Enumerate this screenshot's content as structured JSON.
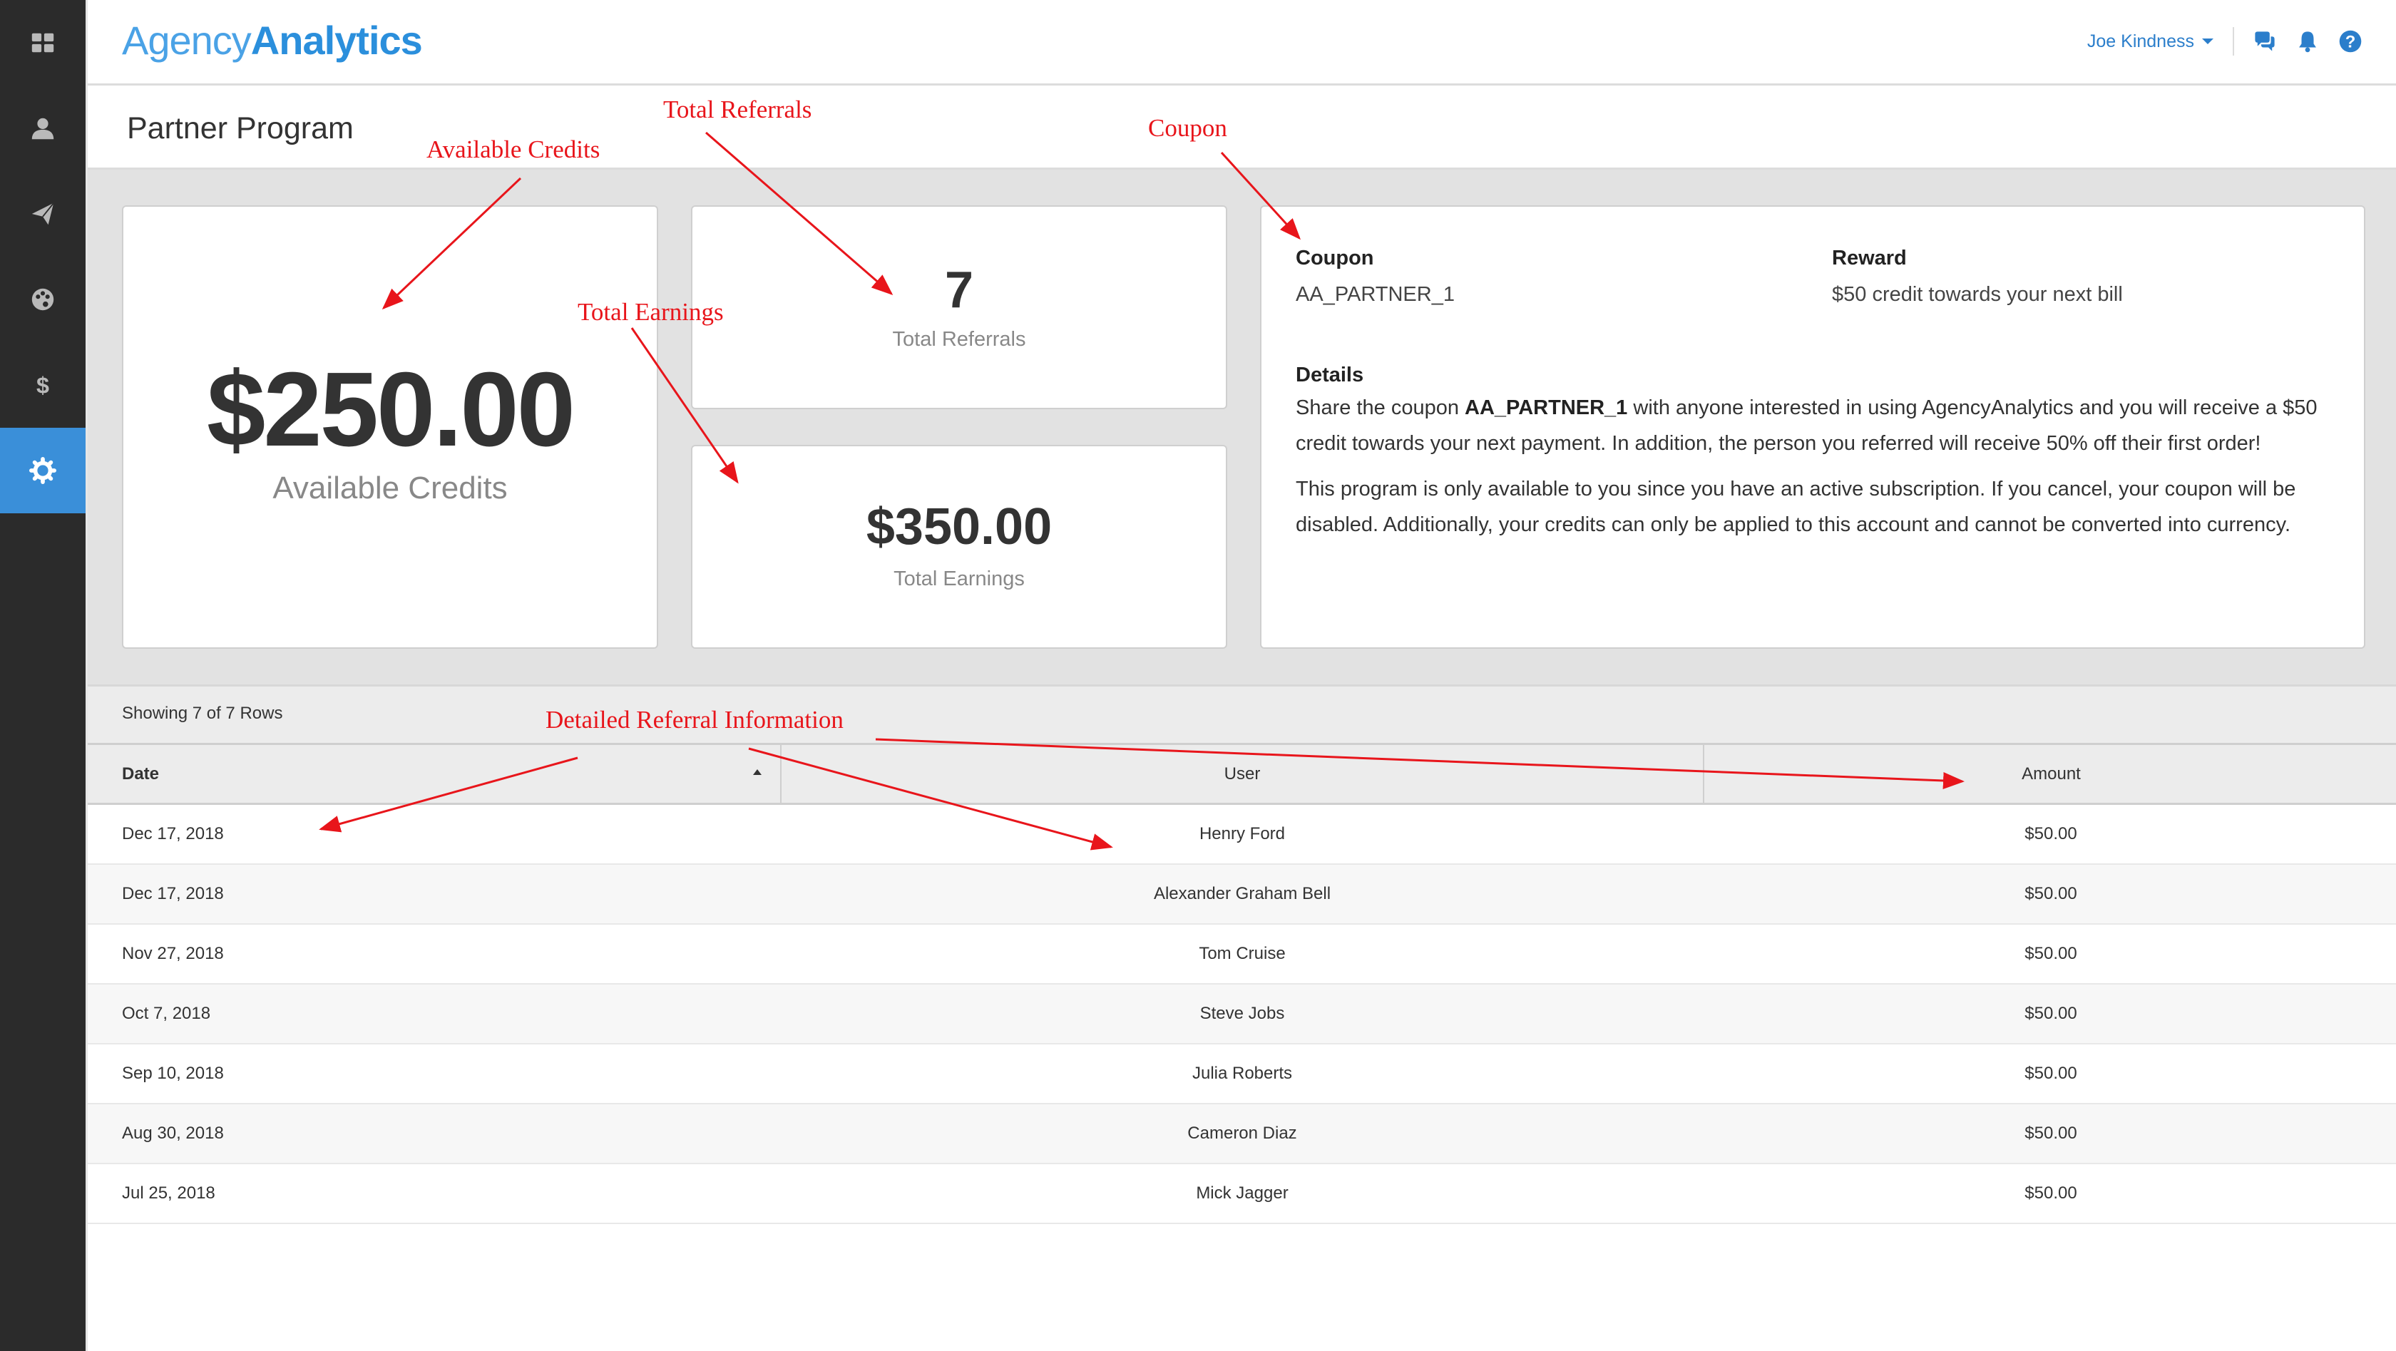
{
  "brand": {
    "logo_light": "Agency",
    "logo_bold": "Analytics",
    "accent": "#2b8fdc"
  },
  "sidebar": {
    "items": [
      {
        "icon": "dashboard-grid-icon"
      },
      {
        "icon": "user-icon"
      },
      {
        "icon": "paper-plane-icon"
      },
      {
        "icon": "palette-icon"
      },
      {
        "icon": "dollar-icon"
      },
      {
        "icon": "gear-icon",
        "active": true
      }
    ]
  },
  "topbar": {
    "user_name": "Joe Kindness",
    "icons": [
      "chat-icon",
      "bell-icon",
      "help-icon"
    ]
  },
  "page": {
    "title": "Partner Program"
  },
  "cards": {
    "credits": {
      "value": "$250.00",
      "label": "Available Credits"
    },
    "referrals": {
      "value": "7",
      "label": "Total Referrals"
    },
    "earnings": {
      "value": "$350.00",
      "label": "Total Earnings"
    }
  },
  "coupon": {
    "coupon_head": "Coupon",
    "coupon_code": "AA_PARTNER_1",
    "reward_head": "Reward",
    "reward_text": "$50 credit towards your next bill",
    "details_head": "Details",
    "details_p1_pre": "Share the coupon ",
    "details_p1_code": "AA_PARTNER_1",
    "details_p1_post": " with anyone interested in using AgencyAnalytics and you will receive a $50 credit towards your next payment. In addition, the person you referred will receive 50% off their first order!",
    "details_p2": "This program is only available to you since you have an active subscription. If you cancel, your coupon will be disabled. Additionally, your credits can only be applied to this account and cannot be converted into currency."
  },
  "table": {
    "info": "Showing 7 of 7 Rows",
    "headers": {
      "date": "Date",
      "user": "User",
      "amount": "Amount"
    },
    "rows": [
      {
        "date": "Dec 17, 2018",
        "user": "Henry Ford",
        "amount": "$50.00"
      },
      {
        "date": "Dec 17, 2018",
        "user": "Alexander Graham Bell",
        "amount": "$50.00"
      },
      {
        "date": "Nov 27, 2018",
        "user": "Tom Cruise",
        "amount": "$50.00"
      },
      {
        "date": "Oct 7, 2018",
        "user": "Steve Jobs",
        "amount": "$50.00"
      },
      {
        "date": "Sep 10, 2018",
        "user": "Julia Roberts",
        "amount": "$50.00"
      },
      {
        "date": "Aug 30, 2018",
        "user": "Cameron Diaz",
        "amount": "$50.00"
      },
      {
        "date": "Jul 25, 2018",
        "user": "Mick Jagger",
        "amount": "$50.00"
      }
    ]
  },
  "annotations": {
    "color": "#e8151b",
    "available_credits": "Available Credits",
    "total_referrals": "Total Referrals",
    "coupon": "Coupon",
    "total_earnings": "Total Earnings",
    "detailed_referral": "Detailed Referral Information"
  }
}
